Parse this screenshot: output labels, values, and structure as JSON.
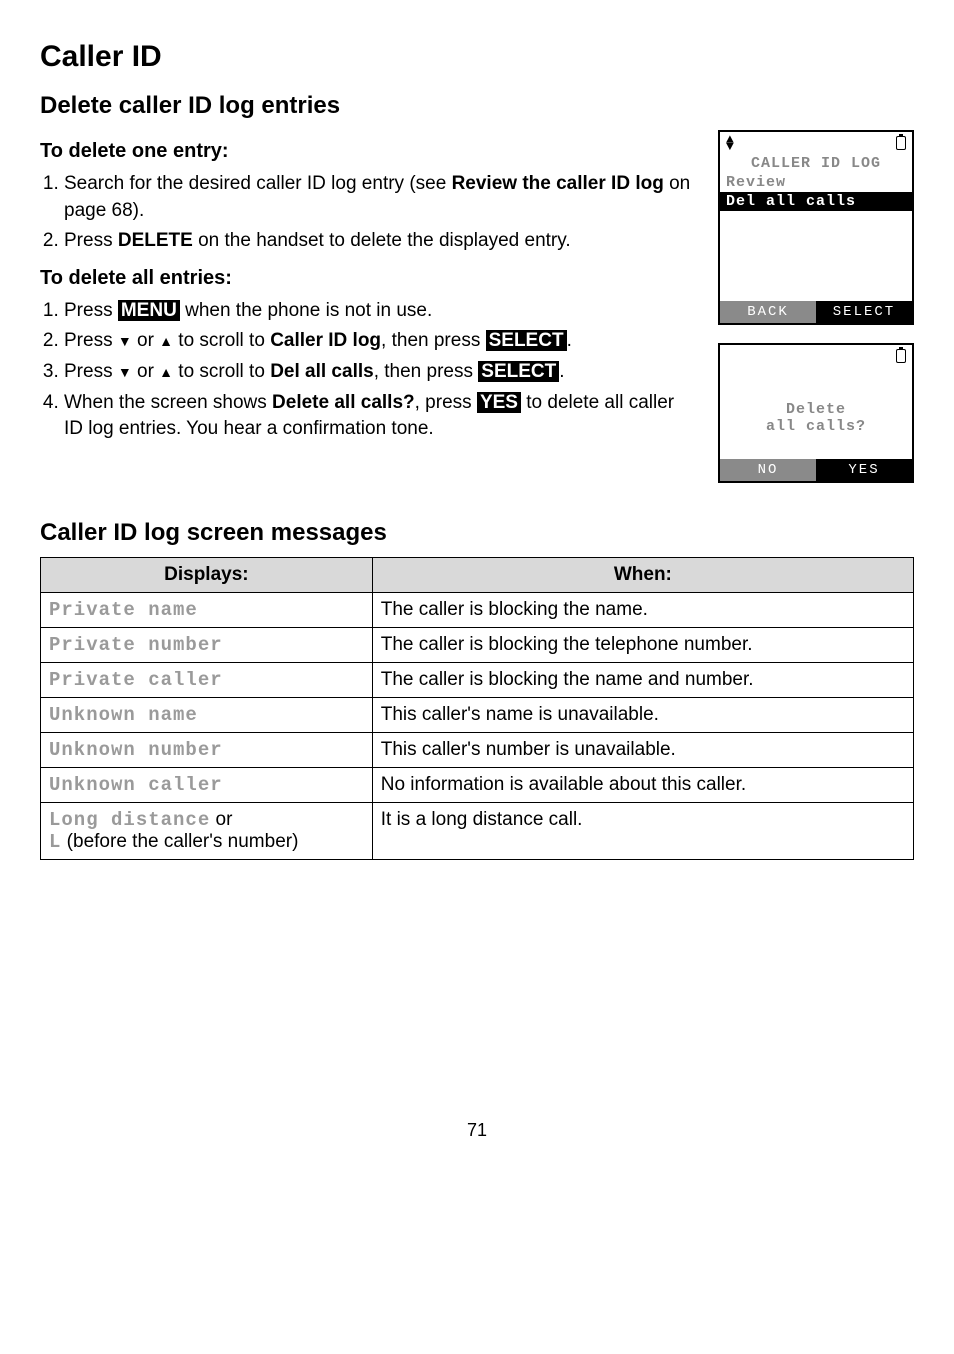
{
  "page": {
    "title": "Caller ID",
    "section1_heading": "Delete caller ID log entries",
    "sub1": "To delete one entry:",
    "sub2": "To delete all entries:",
    "list1": {
      "i1_a": "Search for the desired caller ID log entry (see ",
      "i1_b": "Review the caller ID log",
      "i1_c": " on page 68).",
      "i2_a": "Press ",
      "i2_b": "DELETE",
      "i2_c": " on the handset to delete the displayed entry."
    },
    "list2": {
      "i1_a": "Press ",
      "i1_menu": "MENU",
      "i1_b": " when the phone is not in use.",
      "i2_a": "Press ",
      "i2_b": " or ",
      "i2_c": " to scroll to ",
      "i2_d": "Caller ID log",
      "i2_e": ", then press ",
      "i2_select": "SELECT",
      "i2_f": ".",
      "i3_a": "Press ",
      "i3_b": " or ",
      "i3_c": " to scroll to ",
      "i3_d": "Del all calls",
      "i3_e": ", then press ",
      "i3_select": "SELECT",
      "i3_f": ".",
      "i4_a": "When the screen shows ",
      "i4_b": "Delete all calls?",
      "i4_c": ", press ",
      "i4_yes": "YES",
      "i4_d": " to delete all caller ID log entries. You hear a confirmation tone."
    },
    "screen1": {
      "title": "CALLER ID LOG",
      "line1": "Review",
      "line2": "Del all calls",
      "sk_left": "BACK",
      "sk_right": "SELECT"
    },
    "screen2": {
      "line1": "Delete",
      "line2": "all calls?",
      "sk_left": "NO",
      "sk_right": "YES"
    },
    "section2_heading": "Caller ID log screen messages",
    "table": {
      "head_displays": "Displays:",
      "head_when": "When:",
      "rows": [
        {
          "d": "Private name",
          "w": "The caller is blocking the name."
        },
        {
          "d": "Private number",
          "w": "The caller is blocking the telephone number."
        },
        {
          "d": "Private caller",
          "w": "The caller is blocking the name and number."
        },
        {
          "d": "Unknown name",
          "w": "This caller's name is unavailable."
        },
        {
          "d": "Unknown number",
          "w": "This caller's number is unavailable."
        },
        {
          "d": "Unknown caller",
          "w": "No information is available about this caller."
        }
      ],
      "last_d1": "Long distance",
      "last_d_or": " or",
      "last_d2": "L",
      "last_d3": " (before the caller's number)",
      "last_w": "It is a long distance call."
    },
    "pagenum": "71"
  }
}
